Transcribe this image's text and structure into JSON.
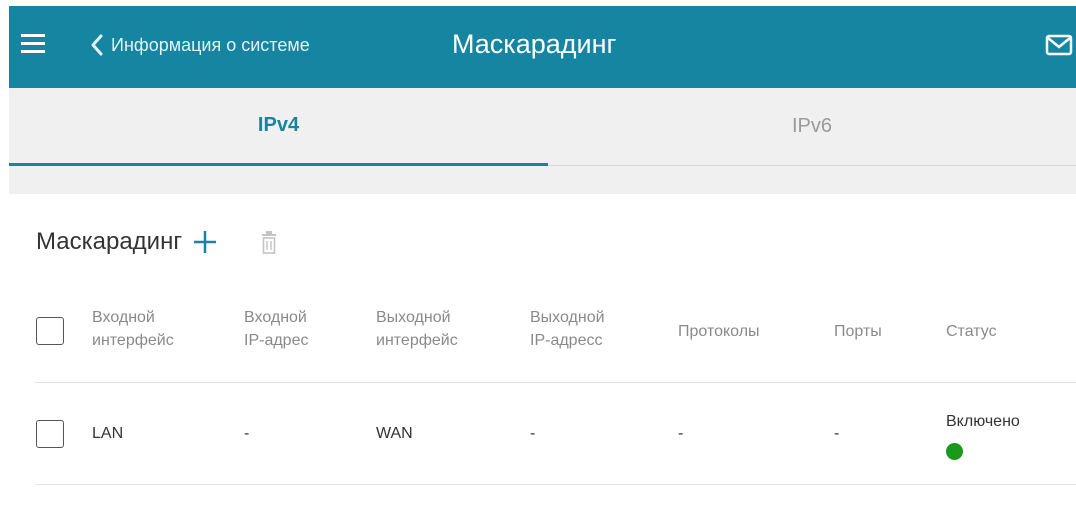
{
  "header": {
    "back_label": "Информация о системе",
    "title": "Маскарадинг",
    "icons": [
      "menu-icon",
      "chevron-left-icon",
      "mail-icon"
    ],
    "accent_color": "#1585a2"
  },
  "tabs": [
    {
      "label": "IPv4",
      "active": true
    },
    {
      "label": "IPv6",
      "active": false
    }
  ],
  "section": {
    "title": "Маскарадинг",
    "icons": [
      "plus-icon",
      "trash-icon"
    ]
  },
  "table": {
    "headers": [
      [
        "Входной",
        "интерфейс"
      ],
      [
        "Входной",
        "IP-адрес"
      ],
      [
        "Выходной",
        "интерфейс"
      ],
      [
        "Выходной",
        "IP-адресс"
      ],
      [
        "Протоколы"
      ],
      [
        "Порты"
      ],
      [
        "Статус"
      ]
    ],
    "rows": [
      {
        "input_interface": "LAN",
        "input_ip": "-",
        "output_interface": "WAN",
        "output_ip": "-",
        "protocols": "-",
        "ports": "-",
        "status": "Включено",
        "status_color": "#1a9a1a"
      }
    ]
  }
}
